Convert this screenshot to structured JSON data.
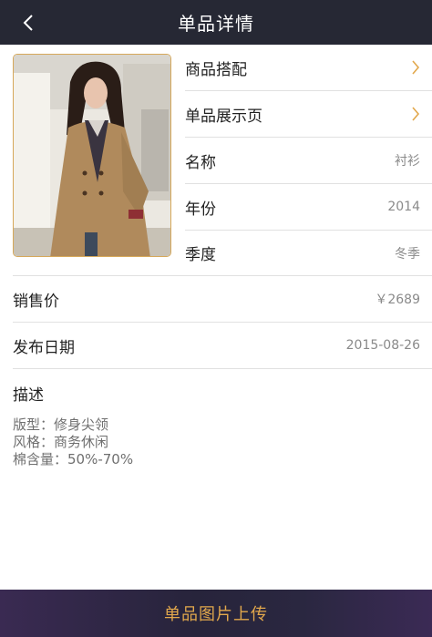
{
  "header": {
    "title": "单品详情",
    "back_icon": "chevron-left-icon"
  },
  "product": {
    "image_alt": "woman in camel coat",
    "border_color": "#d6a85a"
  },
  "details": {
    "match_label": "商品搭配",
    "showcase_label": "单品展示页",
    "name_label": "名称",
    "name_value": "衬衫",
    "year_label": "年份",
    "year_value": "2014",
    "season_label": "季度",
    "season_value": "冬季",
    "price_label": "销售价",
    "price_value": "￥2689",
    "release_label": "发布日期",
    "release_value": "2015-08-26"
  },
  "description": {
    "title": "描述",
    "lines": [
      "版型：修身尖领",
      "风格：商务休闲",
      "棉含量：50%-70%"
    ]
  },
  "footer": {
    "upload_label": "单品图片上传"
  },
  "colors": {
    "topbar": "#262834",
    "accent": "#e2a84c",
    "divider": "#e1e1e1"
  }
}
